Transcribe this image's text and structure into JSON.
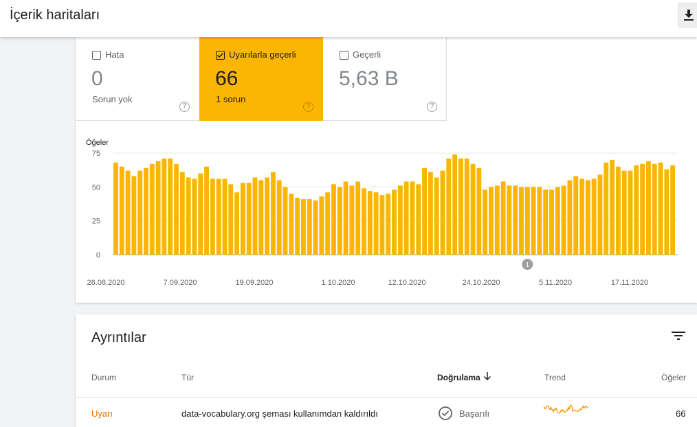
{
  "header": {
    "title": "İçerik haritaları",
    "download_icon": "download-icon"
  },
  "summary": {
    "error": {
      "label": "Hata",
      "value": "0",
      "sub": "Sorun yok",
      "checked": false
    },
    "warnings": {
      "label": "Uyarılarla geçerli",
      "value": "66",
      "sub": "1 sorun",
      "checked": true,
      "color": "#fbb503"
    },
    "valid": {
      "label": "Geçerli",
      "value": "5,63 B",
      "checked": false
    }
  },
  "chart_data": {
    "type": "bar",
    "ylabel": "Öğeler",
    "ylim": [
      0,
      75
    ],
    "yticks": [
      "0",
      "25",
      "50",
      "75"
    ],
    "color": "#fbb503",
    "grid": true,
    "xticks": [
      "26.08.2020",
      "7.09.2020",
      "19.09.2020",
      "1.10.2020",
      "12.10.2020",
      "24.10.2020",
      "5.11.2020",
      "17.11.2020"
    ],
    "annotations": [
      {
        "label": "1",
        "index": 68
      },
      {
        "label": "1",
        "index": 107
      }
    ],
    "values": [
      68,
      65,
      62,
      58,
      62,
      64,
      67,
      69,
      71,
      71,
      67,
      61,
      57,
      56,
      60,
      65,
      56,
      56,
      56,
      52,
      46,
      53,
      53,
      57,
      55,
      57,
      61,
      55,
      50,
      45,
      42,
      41,
      41,
      40,
      43,
      46,
      52,
      50,
      54,
      51,
      54,
      49,
      47,
      46,
      44,
      45,
      48,
      51,
      54,
      54,
      52,
      64,
      61,
      57,
      62,
      71,
      74,
      71,
      71,
      67,
      64,
      48,
      50,
      51,
      54,
      51,
      51,
      50,
      50,
      50,
      50,
      48,
      48,
      50,
      51,
      55,
      58,
      56,
      55,
      56,
      59,
      68,
      70,
      65,
      62,
      62,
      66,
      67,
      69,
      67,
      68,
      63,
      66
    ]
  },
  "details": {
    "title": "Ayrıntılar",
    "filter_icon": "filter-icon",
    "columns": {
      "status": "Durum",
      "type": "Tür",
      "validation": "Doğrulama",
      "trend": "Trend",
      "items": "Öğeler"
    },
    "rows": [
      {
        "status": "Uyarı",
        "type": "data-vocabulary.org şeması kullanımdan kaldırıldı",
        "validation": "Başarılı",
        "items": "66"
      }
    ]
  }
}
